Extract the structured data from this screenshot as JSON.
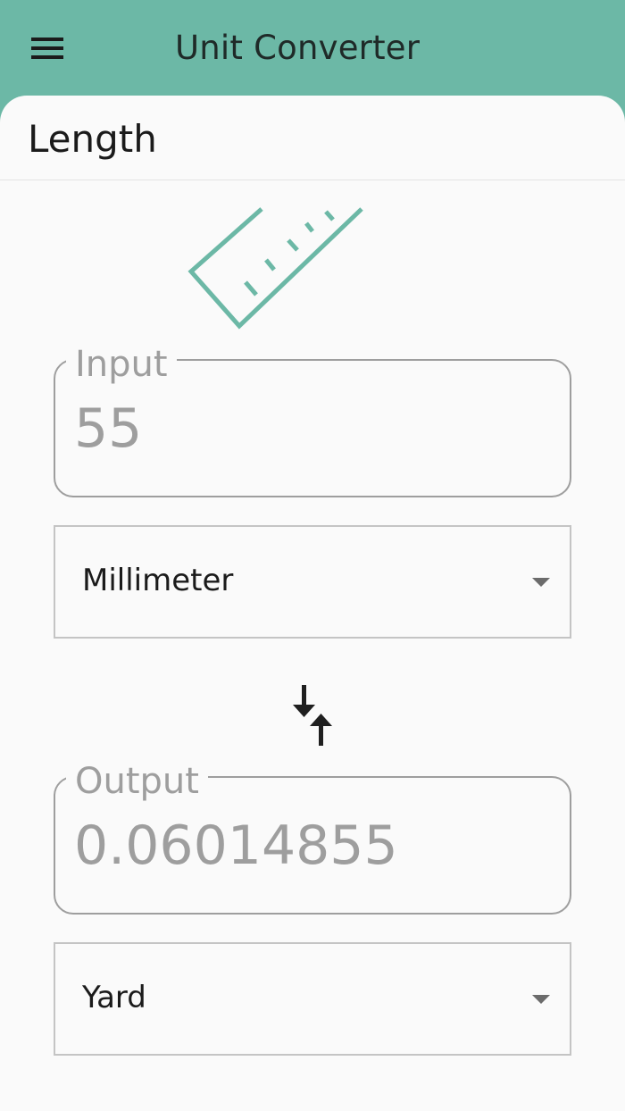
{
  "app": {
    "title": "Unit Converter",
    "accent_color": "#6cb8a6",
    "menu_icon": "menu-icon"
  },
  "category": {
    "title": "Length",
    "icon": "ruler-icon"
  },
  "input": {
    "label": "Input",
    "value": "55",
    "unit": "Millimeter"
  },
  "swap": {
    "icon": "swap-vertical-icon"
  },
  "output": {
    "label": "Output",
    "value": "0.06014855",
    "unit": "Yard"
  }
}
